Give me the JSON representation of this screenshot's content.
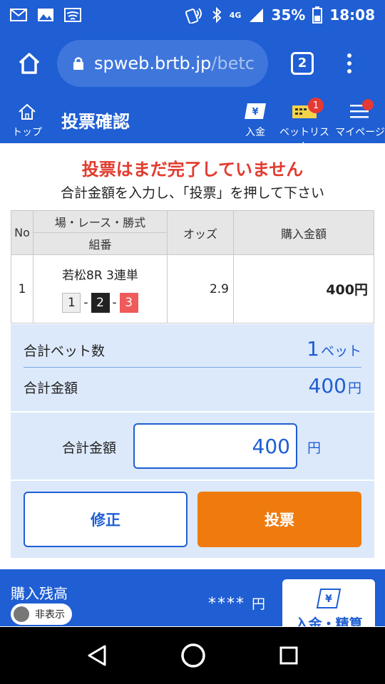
{
  "status_bar": {
    "battery": "35%",
    "time": "18:08",
    "network": "4G"
  },
  "browser": {
    "url_domain": "spweb.brtb.jp",
    "url_rest": "/betc",
    "tab_count": "2"
  },
  "header": {
    "title": "投票確認",
    "top_label": "トップ",
    "deposit_label": "入金",
    "betlist_label": "ベットリスト",
    "betlist_badge": "1",
    "mypage_label": "マイページ"
  },
  "notice": {
    "warning": "投票はまだ完了していません",
    "instruction": "合計金額を入力し、「投票」を押して下さい"
  },
  "table": {
    "headers": {
      "no": "No",
      "race_top": "場・レース・勝式",
      "race_bottom": "組番",
      "odds": "オッズ",
      "amount": "購入金額"
    },
    "rows": [
      {
        "no": "1",
        "race": "若松8R 3連単",
        "combo": [
          "1",
          "2",
          "3"
        ],
        "sep": "-",
        "odds": "2.9",
        "amount": "400円"
      }
    ]
  },
  "summary": {
    "bet_count_label": "合計ベット数",
    "bet_count_value": "1",
    "bet_count_unit": "ベット",
    "total_label": "合計金額",
    "total_value": "400",
    "total_unit": "円"
  },
  "amount_input": {
    "label": "合計金額",
    "value": "400",
    "unit": "円"
  },
  "buttons": {
    "fix": "修正",
    "vote": "投票"
  },
  "balance": {
    "label": "購入残高",
    "toggle_label": "非表示",
    "value": "****",
    "unit": "円",
    "deposit_button": "入金・精算"
  },
  "colors": {
    "primary": "#1f5ed3",
    "accent": "#ef7b0f",
    "warning": "#e23b2e",
    "panel": "#dce9fb"
  }
}
